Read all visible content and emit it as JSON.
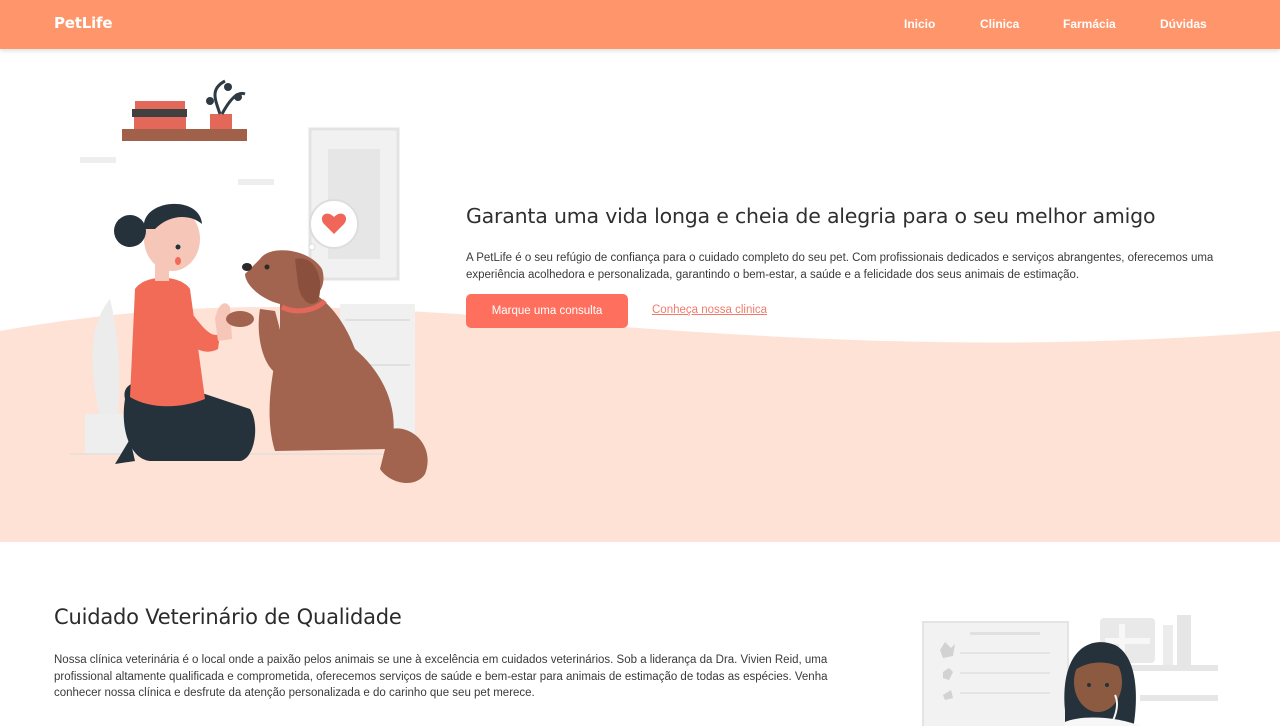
{
  "brand": "PetLife",
  "nav": {
    "items": [
      {
        "label": "Inicio"
      },
      {
        "label": "Clinica"
      },
      {
        "label": "Farmácia"
      },
      {
        "label": "Dúvidas"
      }
    ]
  },
  "hero": {
    "title": "Garanta uma vida longa e cheia de alegria para o seu melhor amigo",
    "text": "A PetLife é o seu refúgio de confiança para o cuidado completo do seu pet. Com profissionais dedicados e serviços abrangentes, oferecemos uma experiência acolhedora e personalizada, garantindo o bem-estar, a saúde e a felicidade dos seus animais de estimação.",
    "primary_button": "Marque uma consulta",
    "secondary_link": "Conheça nossa clinica"
  },
  "section": {
    "title": "Cuidado Veterinário de Qualidade",
    "text": "Nossa clínica veterinária é o local onde a paixão pelos animais se une à excelência em cuidados veterinários. Sob a liderança da Dra. Vivien Reid, uma profissional altamente qualificada e comprometida, oferecemos serviços de saúde e bem-estar para animais de estimação de todas as espécies. Venha conhecer nossa clínica e desfrute da atenção personalizada e do carinho que seu pet merece."
  },
  "colors": {
    "navbar": "#ff956a",
    "accent": "#fe6f5e",
    "hero_wave": "#ffe2d6"
  }
}
